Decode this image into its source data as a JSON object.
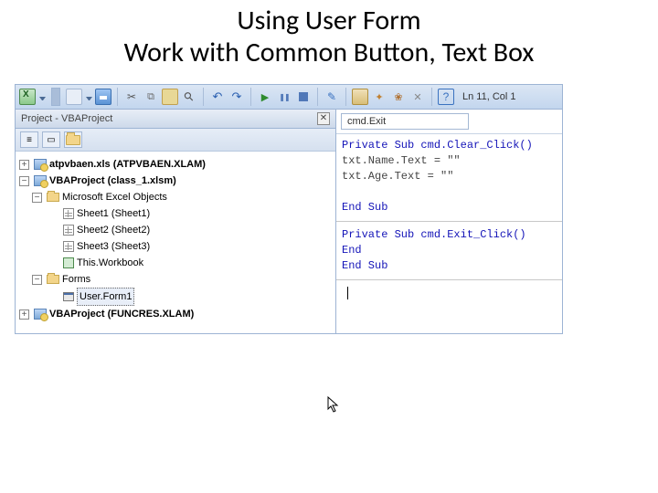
{
  "title_line1": "Using User Form",
  "title_line2": "Work with Common Button, Text Box",
  "toolbar": {
    "status": "Ln 11, Col 1"
  },
  "project_panel": {
    "title": "Project - VBAProject",
    "nodes": {
      "atpvbaen": "atpvbaen.xls (ATPVBAEN.XLAM)",
      "class1": "VBAProject (class_1.xlsm)",
      "excel_objects": "Microsoft Excel Objects",
      "sheet1": "Sheet1 (Sheet1)",
      "sheet2": "Sheet2 (Sheet2)",
      "sheet3": "Sheet3 (Sheet3)",
      "thiswb": "This.Workbook",
      "forms": "Forms",
      "userform": "User.Form1",
      "funcres": "VBAProject (FUNCRES.XLAM)"
    }
  },
  "code_panel": {
    "object_name": "cmd.Exit",
    "sub1_decl": "Private Sub cmd.Clear_Click()",
    "sub1_l1": "txt.Name.Text = \"\"",
    "sub1_l2": "txt.Age.Text = \"\"",
    "end_sub": "End Sub",
    "sub2_decl": "Private Sub cmd.Exit_Click()",
    "end_kw": "End"
  }
}
